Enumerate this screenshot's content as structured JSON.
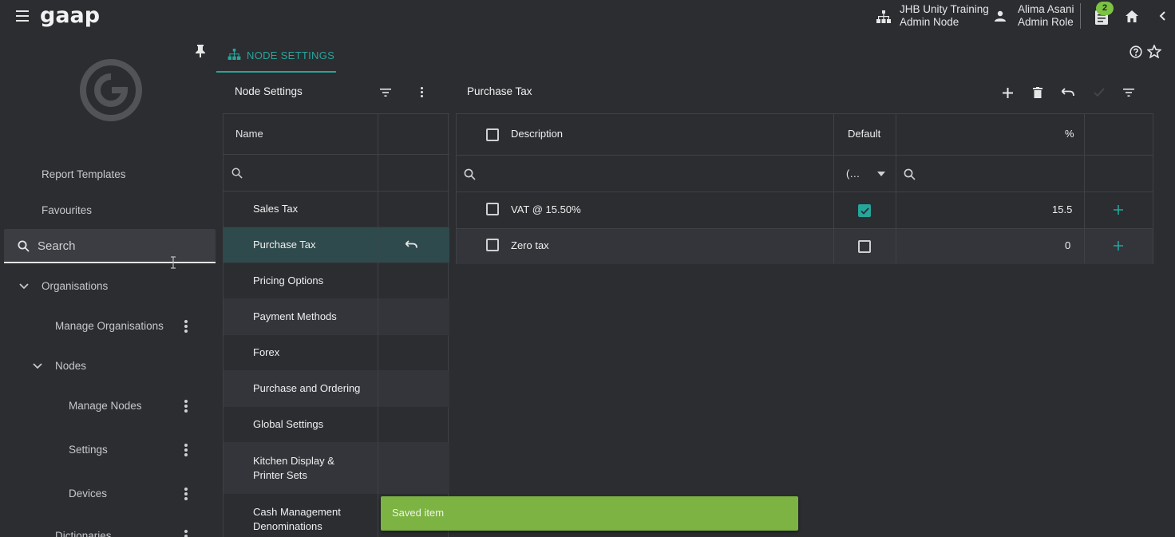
{
  "topbar": {
    "logo": "gaap",
    "node_line1": "JHB Unity Training",
    "node_line2": "Admin Node",
    "user_name": "Alima Asani",
    "user_role": "Admin Role",
    "notification_count": "2"
  },
  "sidebar": {
    "items": {
      "report_templates": "Report Templates",
      "favourites": "Favourites",
      "organisations": "Organisations",
      "manage_organisations": "Manage Organisations",
      "nodes": "Nodes",
      "manage_nodes": "Manage Nodes",
      "settings": "Settings",
      "devices": "Devices",
      "dictionaries": "Dictionaries"
    },
    "search_placeholder": "Search"
  },
  "tab": {
    "label": "NODE SETTINGS"
  },
  "left_panel": {
    "title": "Node Settings",
    "column_name": "Name",
    "rows": [
      "Sales Tax",
      "Purchase Tax",
      "Pricing Options",
      "Payment Methods",
      "Forex",
      "Purchase and Ordering",
      "Global Settings",
      "Kitchen Display &\nPrinter Sets",
      "Cash Management\nDenominations"
    ]
  },
  "right_panel": {
    "title": "Purchase Tax",
    "columns": {
      "description": "Description",
      "default": "Default",
      "percent": "%"
    },
    "default_filter_value": "(…",
    "rows": [
      {
        "description": "VAT @ 15.50%",
        "default": true,
        "percent": "15.5"
      },
      {
        "description": "Zero tax",
        "default": false,
        "percent": "0"
      }
    ]
  },
  "toast": {
    "message": "Saved item"
  },
  "colors": {
    "accent": "#26a59a",
    "toast": "#7cb342",
    "badge": "#7cc243",
    "background": "#2b2d31"
  }
}
